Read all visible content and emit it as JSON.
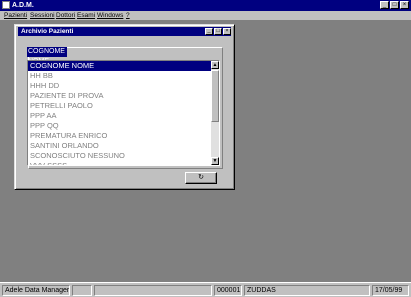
{
  "window": {
    "title": "A.D.M.",
    "min_glyph": "_",
    "max_glyph": "□",
    "close_glyph": "×"
  },
  "menu": {
    "items": [
      "Pazienti",
      "Sessioni",
      "Dottori",
      "Esami",
      "Windows",
      "?"
    ]
  },
  "dialog": {
    "title": "Archivio Pazienti",
    "min_glyph": "_",
    "max_glyph": "□",
    "close_glyph": "×",
    "search_value": "COGNOME NOME",
    "list_items": [
      "COGNOME NOME",
      "HH BB",
      "HHH DD",
      "PAZIENTE DI PROVA",
      "PETRELLI PAOLO",
      "PPP AA",
      "PPP QQ",
      "PREMATURA ENRICO",
      "SANTINI ORLANDO",
      "SCONOSCIUTO NESSUNO",
      "VVV SSSS"
    ],
    "selected_index": 0,
    "ok_glyph": "↻"
  },
  "scrollbar": {
    "up_glyph": "▲",
    "down_glyph": "▼"
  },
  "statusbar": {
    "app_name": "Adele Data Manager",
    "code": "000001",
    "user": "ZUDDAS",
    "date": "17/05/99"
  },
  "colors": {
    "titlebar": "#000080",
    "face": "#c0c0c0",
    "workspace": "#808080",
    "selection": "#000080"
  }
}
